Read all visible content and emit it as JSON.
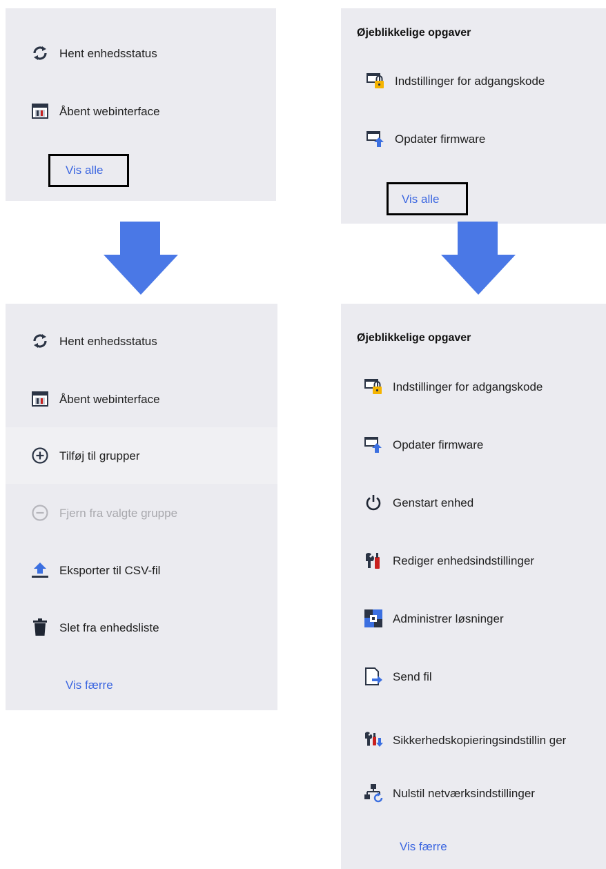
{
  "top_left": {
    "items": [
      {
        "icon": "refresh-icon",
        "label": "Hent enhedsstatus"
      },
      {
        "icon": "web-interface-icon",
        "label": "Åbent webinterface"
      }
    ],
    "link": "Vis alle"
  },
  "top_right": {
    "title": "Øjeblikkelige opgaver",
    "items": [
      {
        "icon": "password-settings-icon",
        "label": "Indstillinger for adgangskode"
      },
      {
        "icon": "update-firmware-icon",
        "label": "Opdater firmware"
      }
    ],
    "link": "Vis alle"
  },
  "bottom_left": {
    "items": [
      {
        "icon": "refresh-icon",
        "label": "Hent enhedsstatus"
      },
      {
        "icon": "web-interface-icon",
        "label": "Åbent webinterface"
      },
      {
        "icon": "add-circle-icon",
        "label": "Tilføj til grupper"
      },
      {
        "icon": "remove-circle-icon",
        "label": "Fjern fra valgte gruppe",
        "disabled": true
      },
      {
        "icon": "export-upload-icon",
        "label": "Eksporter til CSV-fil"
      },
      {
        "icon": "trash-icon",
        "label": "Slet fra enhedsliste"
      }
    ],
    "link": "Vis færre"
  },
  "bottom_right": {
    "title": "Øjeblikkelige opgaver",
    "items": [
      {
        "icon": "password-settings-icon",
        "label": "Indstillinger for adgangskode"
      },
      {
        "icon": "update-firmware-icon",
        "label": "Opdater firmware"
      },
      {
        "icon": "power-icon",
        "label": "Genstart enhed"
      },
      {
        "icon": "device-settings-icon",
        "label": "Rediger enhedsindstillinger"
      },
      {
        "icon": "solutions-icon",
        "label": "Administrer løsninger"
      },
      {
        "icon": "send-file-icon",
        "label": "Send fil"
      },
      {
        "icon": "backup-settings-icon",
        "label": "Sikkerhedskopieringsindstillin ger"
      },
      {
        "icon": "reset-network-icon",
        "label": "Nulstil netværksindstillinger"
      }
    ],
    "link": "Vis færre"
  },
  "colors": {
    "panel": "#ebebf0",
    "link": "#3b66e0",
    "arrow": "#4a78e6",
    "icon_dark": "#2b3445",
    "icon_blue": "#3b6fe0",
    "lock": "#f5b400",
    "red": "#c9201e"
  }
}
